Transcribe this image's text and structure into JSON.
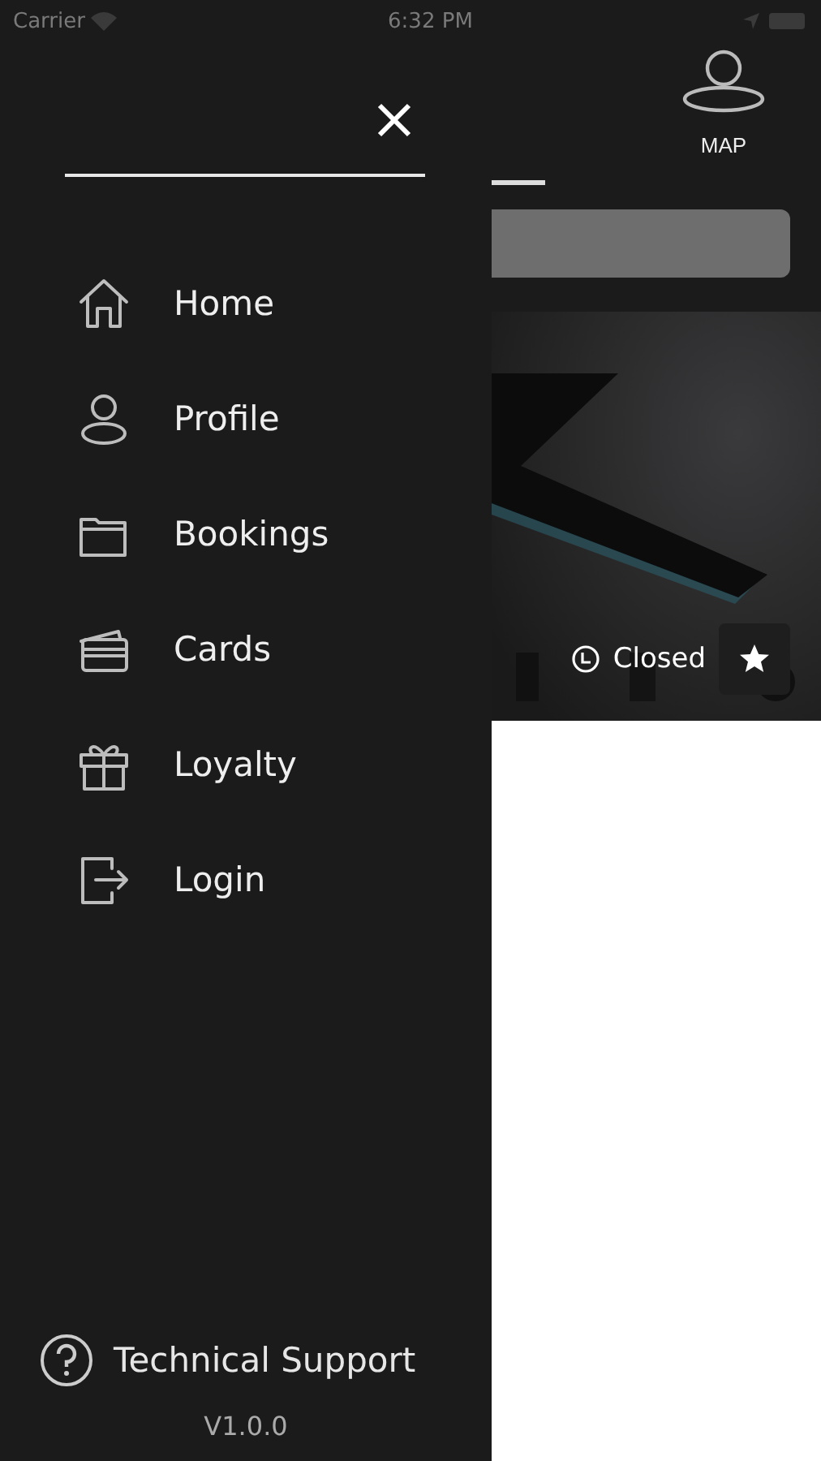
{
  "status_bar": {
    "carrier": "Carrier",
    "time": "6:32 PM"
  },
  "drawer": {
    "items": [
      {
        "kind": "home",
        "label": "Home"
      },
      {
        "kind": "profile",
        "label": "Profile"
      },
      {
        "kind": "bookings",
        "label": "Bookings"
      },
      {
        "kind": "cards",
        "label": "Cards"
      },
      {
        "kind": "loyalty",
        "label": "Loyalty"
      },
      {
        "kind": "login",
        "label": "Login"
      }
    ],
    "support": "Technical Support",
    "version": "V1.0.0"
  },
  "header": {
    "map_label": "MAP"
  },
  "venue_card": {
    "kind": "picture",
    "status": "Closed"
  }
}
